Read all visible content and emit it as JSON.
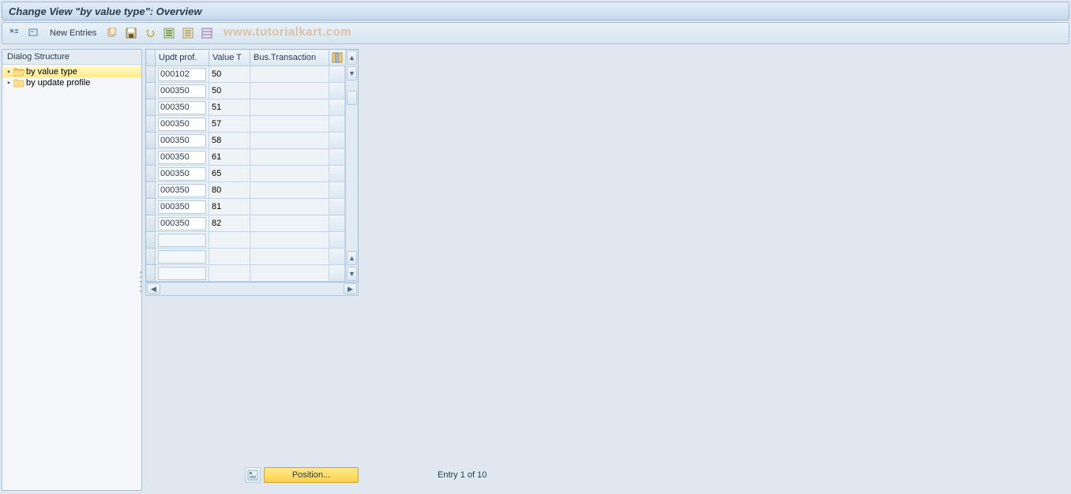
{
  "title": "Change View \"by value type\": Overview",
  "toolbar": {
    "new_entries": "New Entries"
  },
  "watermark": "www.tutorialkart.com",
  "dialog": {
    "header": "Dialog Structure",
    "items": [
      {
        "label": "by value type",
        "selected": true,
        "open": true
      },
      {
        "label": "by update profile",
        "selected": false,
        "open": false
      }
    ]
  },
  "table": {
    "columns": [
      "Updt prof.",
      "Value T",
      "Bus.Transaction"
    ],
    "rows": [
      {
        "updt": "000102",
        "valuet": "50",
        "bus": ""
      },
      {
        "updt": "000350",
        "valuet": "50",
        "bus": ""
      },
      {
        "updt": "000350",
        "valuet": "51",
        "bus": ""
      },
      {
        "updt": "000350",
        "valuet": "57",
        "bus": ""
      },
      {
        "updt": "000350",
        "valuet": "58",
        "bus": ""
      },
      {
        "updt": "000350",
        "valuet": "61",
        "bus": ""
      },
      {
        "updt": "000350",
        "valuet": "65",
        "bus": ""
      },
      {
        "updt": "000350",
        "valuet": "80",
        "bus": ""
      },
      {
        "updt": "000350",
        "valuet": "81",
        "bus": ""
      },
      {
        "updt": "000350",
        "valuet": "82",
        "bus": ""
      },
      {
        "updt": "",
        "valuet": "",
        "bus": ""
      },
      {
        "updt": "",
        "valuet": "",
        "bus": ""
      },
      {
        "updt": "",
        "valuet": "",
        "bus": ""
      }
    ]
  },
  "footer": {
    "position": "Position...",
    "entry": "Entry 1 of 10"
  }
}
